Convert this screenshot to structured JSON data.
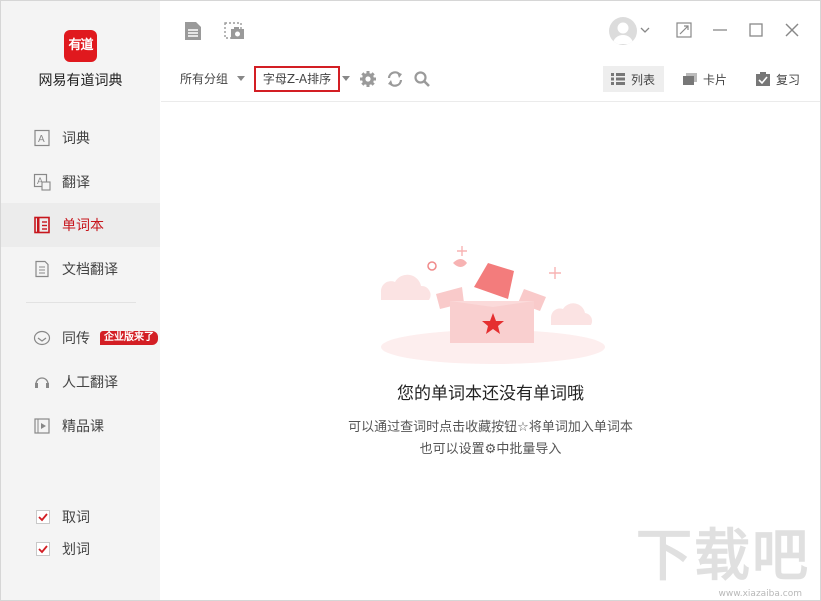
{
  "app": {
    "name": "网易有道词典",
    "logo_text": "有道",
    "brand_color": "#e0191e"
  },
  "sidebar": {
    "items": [
      {
        "label": "词典"
      },
      {
        "label": "翻译"
      },
      {
        "label": "单词本",
        "active": true
      },
      {
        "label": "文档翻译"
      },
      {
        "label": "同传",
        "badge": "企业版来了"
      },
      {
        "label": "人工翻译"
      },
      {
        "label": "精品课"
      }
    ],
    "checkboxes": [
      {
        "label": "取词",
        "checked": true
      },
      {
        "label": "划词",
        "checked": true
      }
    ]
  },
  "toolbar": {
    "group_select": "所有分组",
    "sort_select": "字母Z-A排序",
    "views": [
      {
        "label": "列表",
        "active": true
      },
      {
        "label": "卡片"
      },
      {
        "label": "复习"
      }
    ]
  },
  "empty_state": {
    "title": "您的单词本还没有单词哦",
    "line1": "可以通过查词时点击收藏按钮☆将单词加入单词本",
    "line2": "也可以设置⚙中批量导入"
  },
  "watermark": {
    "text": "下载吧",
    "sub": "www.xiazaiba.com"
  },
  "icons": {
    "toolbar": [
      "document-icon",
      "screenshot-icon"
    ],
    "actions": [
      "settings-icon",
      "sync-icon",
      "search-icon"
    ],
    "window": [
      "avatar",
      "restore-icon",
      "minimize-icon",
      "maximize-icon",
      "close-icon"
    ]
  }
}
